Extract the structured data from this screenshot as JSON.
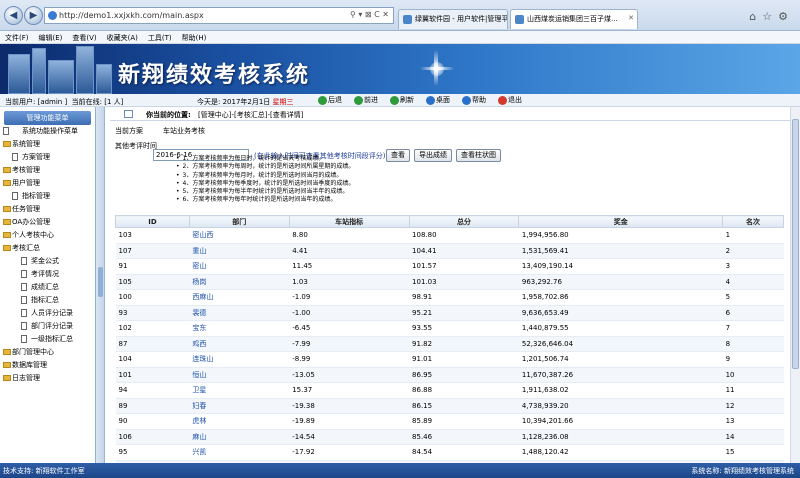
{
  "browser": {
    "url": "http://demo1.xxjxkh.com/main.aspx",
    "tabs": [
      {
        "label": "绿翼软件园 - 用户软件|管理平台"
      },
      {
        "label": "山西煤炭运销集团三百子煤..."
      }
    ],
    "menu": [
      "文件(F)",
      "编辑(E)",
      "查看(V)",
      "收藏夹(A)",
      "工具(T)",
      "帮助(H)"
    ]
  },
  "banner": {
    "title": "新翔绩效考核系统"
  },
  "infobar": {
    "user": "当前用户: [admin ]",
    "online": "当前在线: [1 人]",
    "today_label": "今天是: 2017年2月1日",
    "weekday": "星期三",
    "actions": [
      {
        "label": "后退",
        "icon": "back-icon",
        "color": "#2e9a3a"
      },
      {
        "label": "前进",
        "icon": "forward-icon",
        "color": "#2e9a3a"
      },
      {
        "label": "刷新",
        "icon": "refresh-icon",
        "color": "#2e9a3a"
      },
      {
        "label": "桌面",
        "icon": "desktop-icon",
        "color": "#2a6fc9"
      },
      {
        "label": "帮助",
        "icon": "help-icon",
        "color": "#2a6fc9"
      },
      {
        "label": "退出",
        "icon": "exit-icon",
        "color": "#d23b2b"
      }
    ]
  },
  "sidebar": {
    "header": "管理功能菜单",
    "items": [
      {
        "label": "系统功能操作菜单",
        "level": "ph"
      },
      {
        "label": "系统管理",
        "level": "lv0"
      },
      {
        "label": "方案管理",
        "level": "lv1"
      },
      {
        "label": "考核管理",
        "level": "lv0"
      },
      {
        "label": "用户管理",
        "level": "lv0"
      },
      {
        "label": "指标管理",
        "level": "lv1"
      },
      {
        "label": "任务管理",
        "level": "lv0"
      },
      {
        "label": "OA办公管理",
        "level": "lv0"
      },
      {
        "label": "个人考核中心",
        "level": "lv0"
      },
      {
        "label": "考核汇总",
        "level": "lv0"
      },
      {
        "label": "奖金公式",
        "level": "lv2"
      },
      {
        "label": "考评情况",
        "level": "lv2"
      },
      {
        "label": "成绩汇总",
        "level": "lv2"
      },
      {
        "label": "指标汇总",
        "level": "lv2"
      },
      {
        "label": "人员评分记录",
        "level": "lv2"
      },
      {
        "label": "部门评分记录",
        "level": "lv2"
      },
      {
        "label": "一级指标汇总",
        "level": "lv2"
      },
      {
        "label": "部门管理中心",
        "level": "lv0"
      },
      {
        "label": "数据库管理",
        "level": "lv0"
      },
      {
        "label": "日志管理",
        "level": "lv0"
      }
    ]
  },
  "location": {
    "label": "你当前的位置:",
    "value": "[管理中心]-[考核汇总]-[查看详情]"
  },
  "form": {
    "plan_label": "当前方案",
    "plan_value": "车站业务考核",
    "time_label": "其他考评时间",
    "time_value": "2016-6-16",
    "hint": "(在此输入时间可查看其他考核时间段评分)",
    "buttons": [
      "查看",
      "导出成绩",
      "查看柱状图"
    ]
  },
  "notes": [
    "1、方案考核频率为每日时，统计的是当天考核成绩。",
    "2、方案考核频率为每周时，统计的是所选时间所属星期的成绩。",
    "3、方案考核频率为每月时，统计的是所选时间当月的成绩。",
    "4、方案考核频率为每季度时，统计的是所选时间当季度的成绩。",
    "5、方案考核频率为每半年时统计的是所选时间当半年的成绩。",
    "6、方案考核频率为每年时统计的是所选时间当年的成绩。"
  ],
  "table": {
    "headers": [
      "ID",
      "部门",
      "车站指标",
      "总分",
      "奖金",
      "名次"
    ],
    "rows": [
      [
        "103",
        "密山西",
        "8.80",
        "108.80",
        "1,994,956.80",
        "1"
      ],
      [
        "107",
        "重山",
        "4.41",
        "104.41",
        "1,531,569.41",
        "2"
      ],
      [
        "91",
        "密山",
        "11.45",
        "101.57",
        "13,409,190.14",
        "3"
      ],
      [
        "105",
        "杨岗",
        "1.03",
        "101.03",
        "963,292.76",
        "4"
      ],
      [
        "100",
        "西麻山",
        "-1.09",
        "98.91",
        "1,958,702.86",
        "5"
      ],
      [
        "93",
        "裴德",
        "-1.00",
        "95.21",
        "9,636,653.49",
        "6"
      ],
      [
        "102",
        "宝东",
        "-6.45",
        "93.55",
        "1,440,879.55",
        "7"
      ],
      [
        "87",
        "鸡西",
        "-7.99",
        "91.82",
        "52,326,646.04",
        "8"
      ],
      [
        "104",
        "连珠山",
        "-8.99",
        "91.01",
        "1,201,506.74",
        "9"
      ],
      [
        "101",
        "恒山",
        "-13.05",
        "86.95",
        "11,670,387.26",
        "10"
      ],
      [
        "94",
        "卫星",
        "15.37",
        "86.88",
        "1,911,638.02",
        "11"
      ],
      [
        "89",
        "妇春",
        "-19.38",
        "86.15",
        "4,738,939.20",
        "12"
      ],
      [
        "90",
        "虎林",
        "-19.89",
        "85.89",
        "10,394,201.66",
        "13"
      ],
      [
        "106",
        "麻山",
        "-14.54",
        "85.46",
        "1,128,236.08",
        "14"
      ],
      [
        "95",
        "兴凯",
        "-17.92",
        "84.54",
        "1,488,120.42",
        "15"
      ],
      [
        "88",
        "东方红",
        "-24.11",
        "83.78",
        "3,994,094.21",
        "16"
      ]
    ]
  },
  "status": {
    "left": "技术支持: 新翔软件工作室",
    "right": "系统名称: 新翔绩效考核管理系统"
  }
}
